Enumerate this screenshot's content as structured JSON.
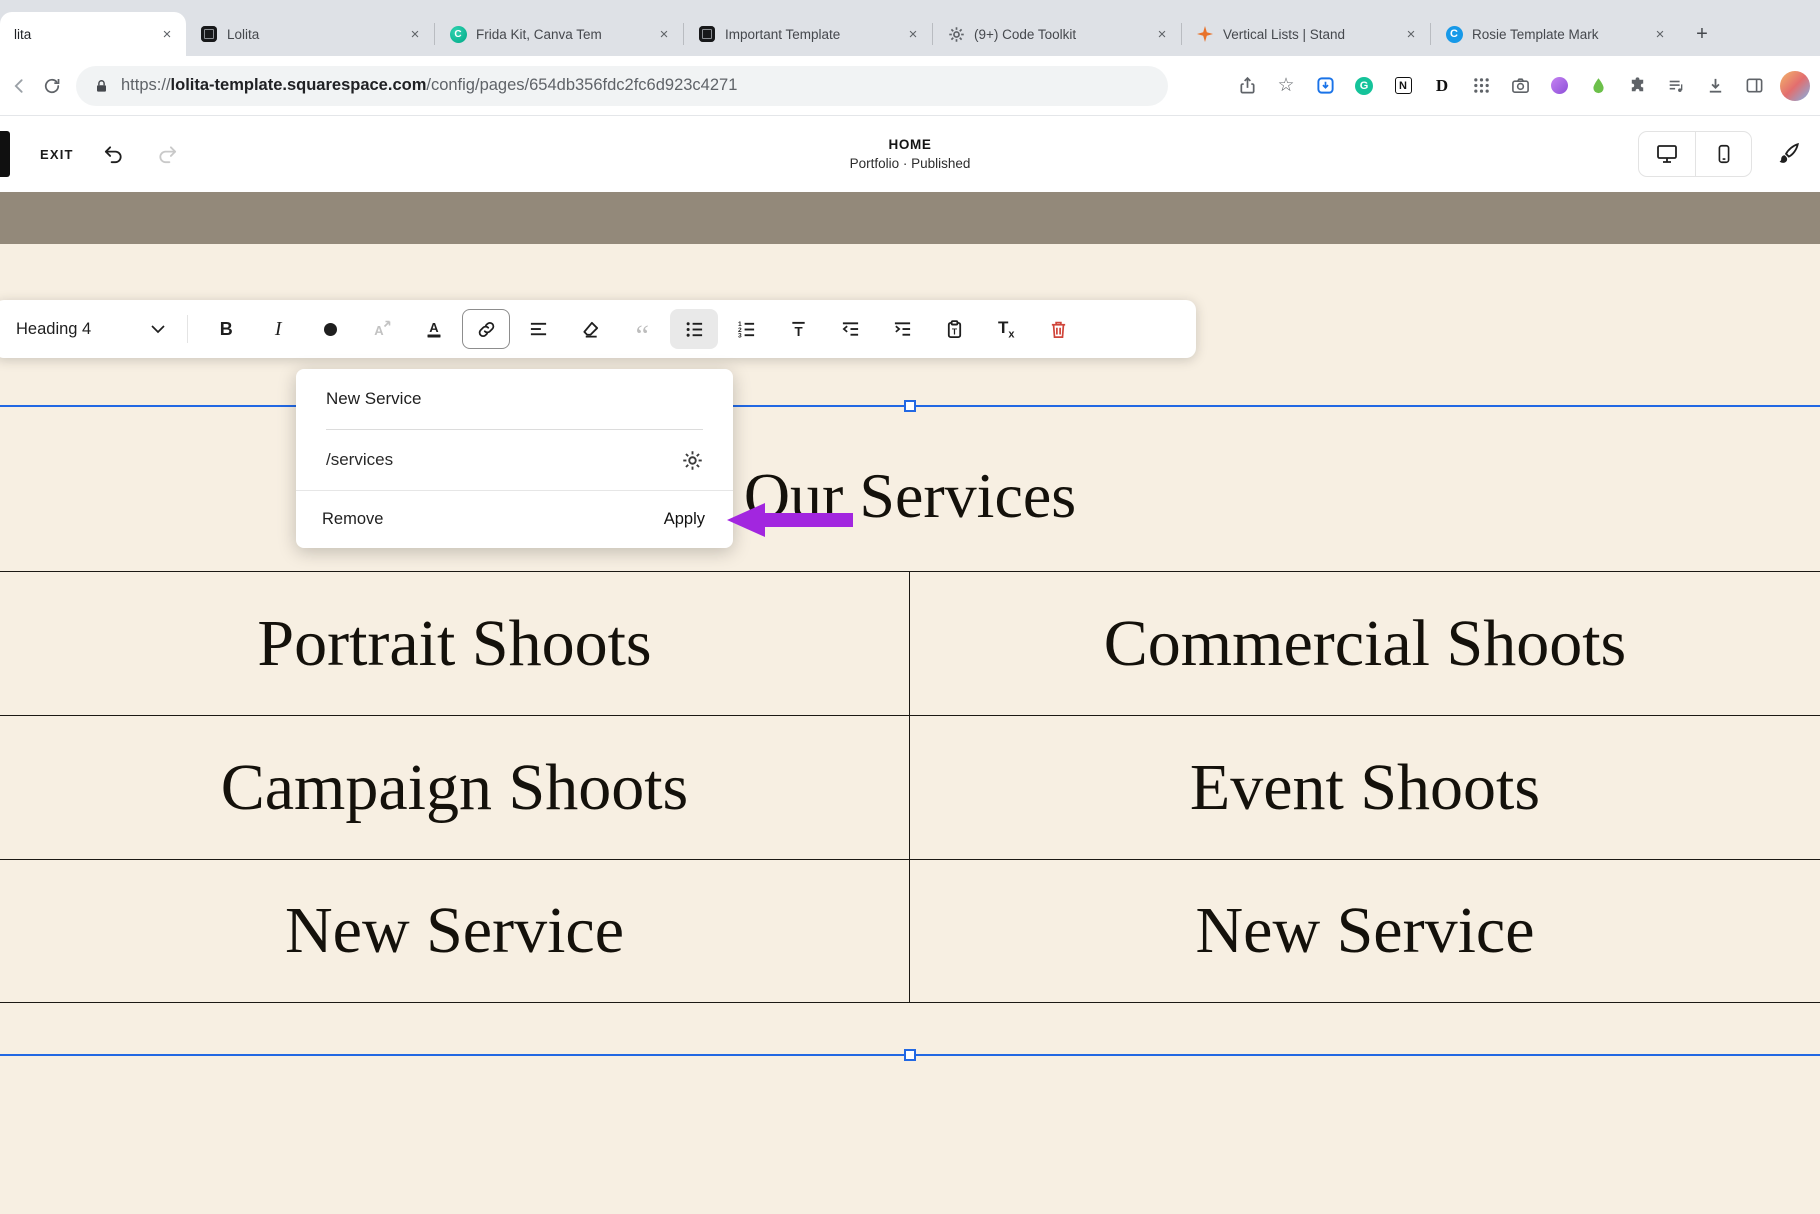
{
  "browser": {
    "tabs": [
      {
        "label": "lita"
      },
      {
        "label": "Lolita"
      },
      {
        "label": "Frida Kit, Canva Tem"
      },
      {
        "label": "Important Template"
      },
      {
        "label": "(9+) Code Toolkit"
      },
      {
        "label": "Vertical Lists | Stand"
      },
      {
        "label": "Rosie Template Mark"
      }
    ],
    "address": {
      "protocol": "https://",
      "domain": "lolita-template.squarespace.com",
      "path": "/config/pages/654db356fdc2fc6d923c4271"
    }
  },
  "editor_bar": {
    "exit_label": "EXIT",
    "page_title": "HOME",
    "page_status": "Portfolio · Published"
  },
  "text_toolbar": {
    "style_label": "Heading 4",
    "buttons": [
      "bold",
      "italic",
      "text-color",
      "font-size",
      "highlight",
      "link",
      "align",
      "eraser",
      "quote",
      "bulleted-list",
      "numbered-list",
      "strikethrough",
      "outdent",
      "indent",
      "paste-as-text",
      "clear-formatting",
      "delete"
    ],
    "active_buttons": [
      "link",
      "bulleted-list"
    ]
  },
  "link_editor": {
    "text_value": "New Service",
    "url_value": "/services",
    "remove_label": "Remove",
    "apply_label": "Apply"
  },
  "page": {
    "heading": "Our Services",
    "services_table": {
      "rows": [
        [
          "Portrait Shoots",
          "Commercial Shoots"
        ],
        [
          "Campaign Shoots",
          "Event Shoots"
        ],
        [
          "New Service",
          "New Service"
        ]
      ]
    }
  },
  "glyphs": {
    "plus": "+",
    "close": "×",
    "bold": "B",
    "italic": "I",
    "quote": "“",
    "t": "T",
    "x": "x",
    "notion": "N",
    "d": "D",
    "c": "C",
    "g": "G",
    "star": "☆"
  },
  "colors": {
    "selection_blue": "#2268e3",
    "annotation_purple": "#a226df",
    "delete_red": "#d0453a",
    "canvas_cream": "#f7efe2"
  }
}
